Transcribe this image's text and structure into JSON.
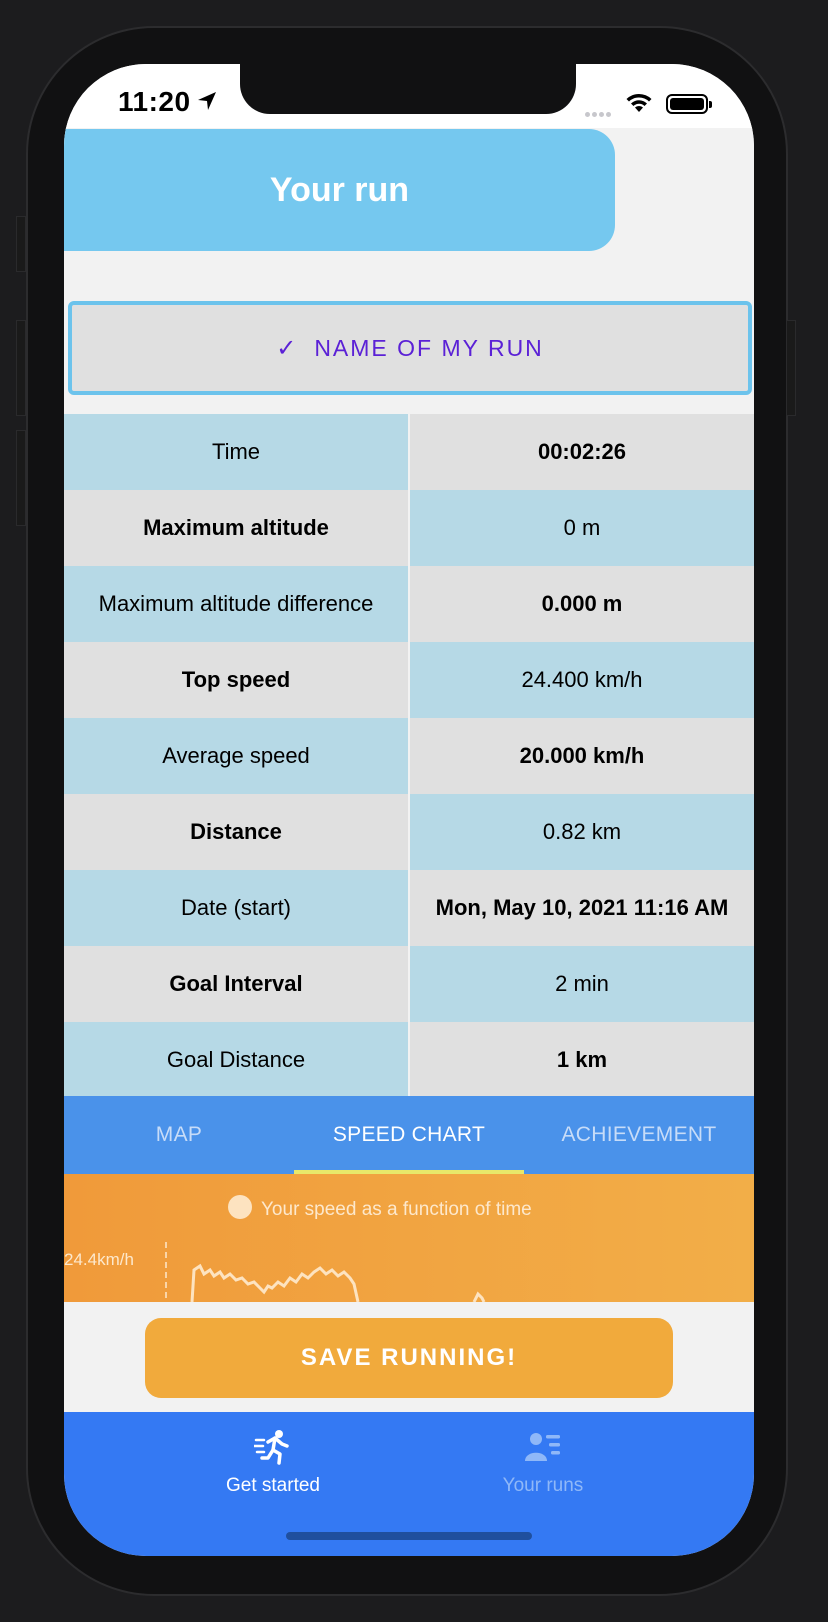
{
  "status_bar": {
    "time": "11:20"
  },
  "header": {
    "title": "Your run"
  },
  "name_button": {
    "check_icon": "✓",
    "label": "NAME OF MY RUN"
  },
  "stats": [
    {
      "label": "Time",
      "value": "00:02:26"
    },
    {
      "label": "Maximum altitude",
      "value": "0 m"
    },
    {
      "label": "Maximum altitude difference",
      "value": "0.000 m"
    },
    {
      "label": "Top speed",
      "value": "24.400 km/h"
    },
    {
      "label": "Average speed",
      "value": "20.000 km/h"
    },
    {
      "label": "Distance",
      "value": "0.82 km"
    },
    {
      "label": "Date (start)",
      "value": "Mon, May 10, 2021 11:16 AM"
    },
    {
      "label": "Goal Interval",
      "value": "2 min"
    },
    {
      "label": "Goal Distance",
      "value": "1 km"
    }
  ],
  "tabs": [
    {
      "label": "MAP",
      "active": false
    },
    {
      "label": "SPEED CHART",
      "active": true
    },
    {
      "label": "ACHIEVEMENT",
      "active": false
    }
  ],
  "chart": {
    "legend": "Your speed as a function of time",
    "y_tick": "24.4km/h"
  },
  "save_button": {
    "label": "SAVE RUNNING!"
  },
  "tabbar": [
    {
      "label": "Get started",
      "icon": "running-person-icon",
      "active": true
    },
    {
      "label": "Your runs",
      "icon": "user-list-icon",
      "active": false
    }
  ],
  "colors": {
    "title_pill": "#75c8ef",
    "accent_purple": "#5b21d6",
    "row_blue": "#b6d9e6",
    "row_grey": "#e0e0e0",
    "tab_bar": "#4a92ea",
    "chart_bg": "#f0a03c",
    "save_button": "#f1aa3c",
    "bottom_bar": "#3479f3"
  }
}
